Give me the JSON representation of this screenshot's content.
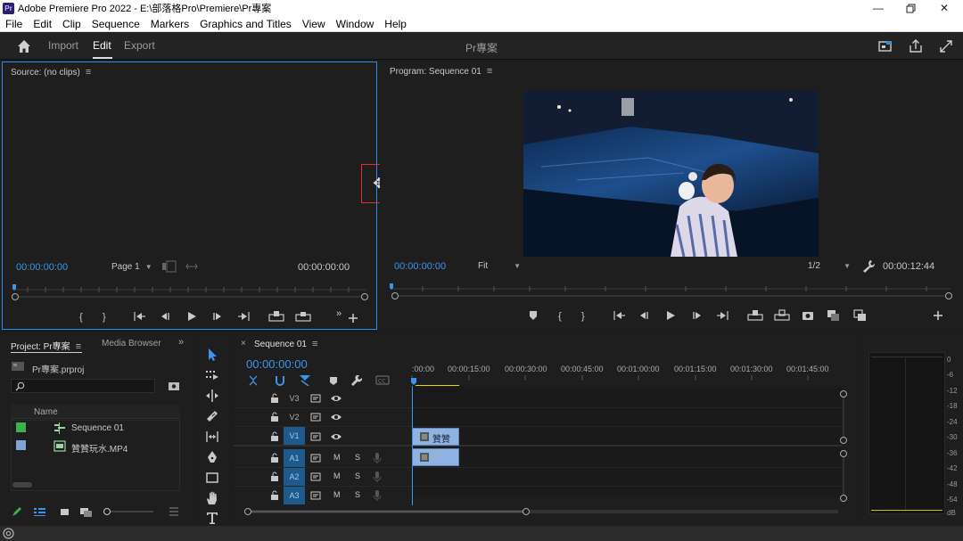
{
  "titlebar": {
    "app_icon": "Pr",
    "title": "Adobe Premiere Pro 2022 - E:\\部落格Pro\\Premiere\\Pr專案",
    "controls": [
      "minimize-icon",
      "restore-icon",
      "close-icon"
    ]
  },
  "menubar": [
    "File",
    "Edit",
    "Clip",
    "Sequence",
    "Markers",
    "Graphics and Titles",
    "View",
    "Window",
    "Help"
  ],
  "header": {
    "tabs": [
      {
        "label": "Import",
        "active": false
      },
      {
        "label": "Edit",
        "active": true
      },
      {
        "label": "Export",
        "active": false
      }
    ],
    "project_name": "Pr專案",
    "right_icons": [
      "quick-export-icon",
      "share-icon",
      "fullscreen-icon"
    ]
  },
  "source_monitor": {
    "title": "Source: (no clips)",
    "timecode_in": "00:00:00:00",
    "page_select": "Page 1",
    "timecode_out": "00:00:00:00"
  },
  "program_monitor": {
    "title": "Program: Sequence 01",
    "timecode_in": "00:00:00:00",
    "fit_select": "Fit",
    "resolution_select": "1/2",
    "duration": "00:00:12:44"
  },
  "project_panel": {
    "tab_project": "Project: Pr專案",
    "tab_media_browser": "Media Browser",
    "file_name": "Pr專案.prproj",
    "column_name": "Name",
    "items": [
      {
        "name": "Sequence 01",
        "color": "#3cb34a",
        "type": "sequence"
      },
      {
        "name": "贊贊玩水.MP4",
        "color": "#7fa4d8",
        "type": "video"
      }
    ]
  },
  "timeline": {
    "tab_label": "Sequence 01",
    "timecode": "00:00:00:00",
    "ruler": [
      ":00:00",
      "00:00:15:00",
      "00:00:30:00",
      "00:00:45:00",
      "00:01:00:00",
      "00:01:15:00",
      "00:01:30:00",
      "00:01:45:00"
    ],
    "video_tracks": [
      "V3",
      "V2",
      "V1"
    ],
    "audio_tracks": [
      "A1",
      "A2",
      "A3"
    ],
    "clip_label": "贊贊",
    "mute": "M",
    "solo": "S"
  },
  "meter": {
    "scale": [
      "0",
      "-6",
      "-12",
      "-18",
      "-24",
      "-30",
      "-36",
      "-42",
      "-48",
      "-54",
      "dB"
    ]
  },
  "colors": {
    "accent_blue": "#2d8ceb",
    "timecode_blue": "#3b95ea",
    "clip_blue": "#8fb3e0",
    "track_on": "#1f5a8c",
    "marker_red": "#e0302b"
  }
}
